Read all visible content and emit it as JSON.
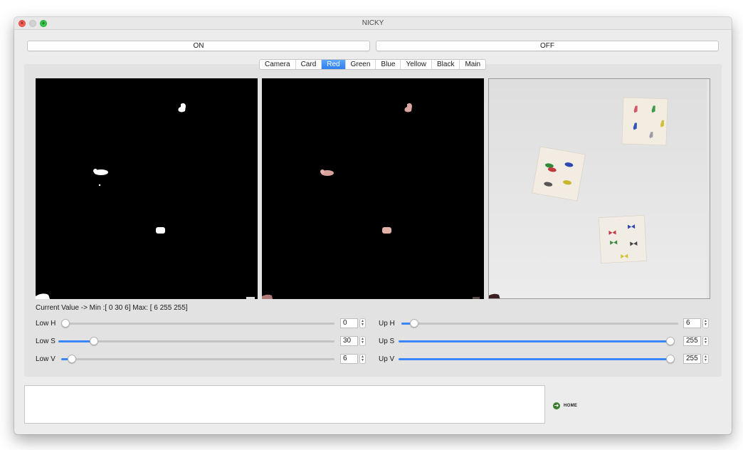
{
  "window": {
    "title": "NICKY"
  },
  "controls": {
    "on_label": "ON",
    "off_label": "OFF"
  },
  "tabs": [
    {
      "label": "Camera",
      "active": false
    },
    {
      "label": "Card",
      "active": false
    },
    {
      "label": "Red",
      "active": true
    },
    {
      "label": "Green",
      "active": false
    },
    {
      "label": "Blue",
      "active": false
    },
    {
      "label": "Yellow",
      "active": false
    },
    {
      "label": "Black",
      "active": false
    },
    {
      "label": "Main",
      "active": false
    }
  ],
  "status": {
    "current_value": "Current Value -> Min :[ 0 30  6] Max: [  6 255 255]"
  },
  "sliders": {
    "low_h": {
      "label": "Low H",
      "value": "0",
      "fraction": 0.0
    },
    "low_s": {
      "label": "Low S",
      "value": "30",
      "fraction": 0.118
    },
    "low_v": {
      "label": "Low V",
      "value": "6",
      "fraction": 0.024
    },
    "up_h": {
      "label": "Up H",
      "value": "6",
      "fraction": 0.033
    },
    "up_s": {
      "label": "Up S",
      "value": "255",
      "fraction": 1.0
    },
    "up_v": {
      "label": "Up V",
      "value": "255",
      "fraction": 1.0
    }
  },
  "home": {
    "label": "HOME"
  },
  "colors": {
    "accent": "#3b86f7",
    "home_icon": "#3a7d2c"
  }
}
